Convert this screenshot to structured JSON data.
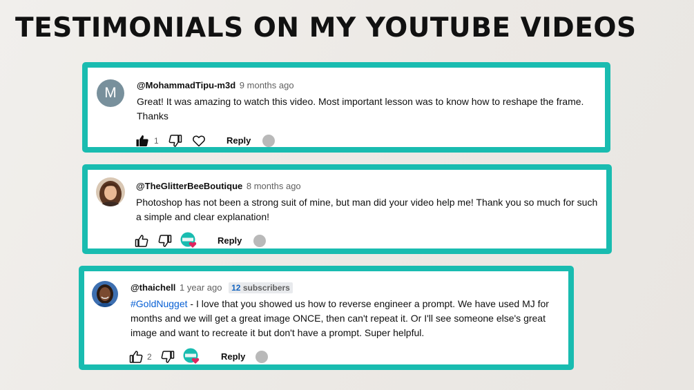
{
  "page": {
    "title": "TESTIMONIALS ON MY YOUTUBE VIDEOS"
  },
  "colors": {
    "accent": "#19bcb0",
    "link": "#065fd4",
    "text": "#0f0f0f",
    "muted": "#606060"
  },
  "comments": [
    {
      "avatar_letter": "M",
      "handle": "@MohammadTipu-m3d",
      "time": "9 months ago",
      "text": "Great! It was amazing to watch this video. Most important lesson was to know how to reshape the frame. Thanks",
      "like_count": "1",
      "liked": true,
      "reply_label": "Reply"
    },
    {
      "handle": "@TheGlitterBeeBoutique",
      "time": "8 months ago",
      "text": "Photoshop has not been a strong suit of mine, but man did your video help me! Thank you so much for such a simple and clear explanation!",
      "hearted": true,
      "reply_label": "Reply"
    },
    {
      "handle": "@thaichell",
      "time": "1 year ago",
      "subscribers_count": "12",
      "subscribers_label": "subscribers",
      "hashtag": "#GoldNugget",
      "text": " - I love that you showed us how to reverse engineer a prompt. We have used MJ for months and we will get a great image ONCE, then can't repeat it. Or I'll see someone else's great image and want to recreate it but don't have a prompt. Super helpful.",
      "like_count": "2",
      "hearted": true,
      "reply_label": "Reply"
    }
  ]
}
